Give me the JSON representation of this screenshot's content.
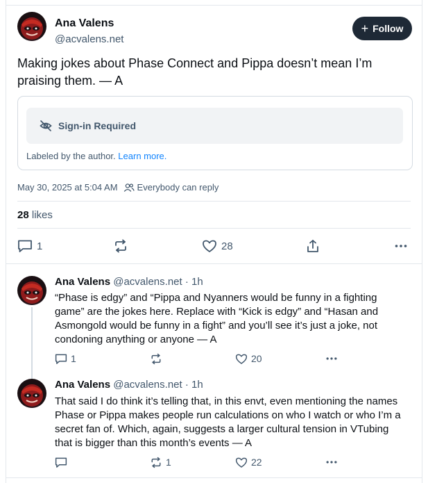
{
  "post": {
    "author_name": "Ana Valens",
    "author_handle": "@acvalens.net",
    "follow_label": "Follow",
    "text": "Making jokes about Phase Connect and Pippa doesn’t mean I’m praising them. — A",
    "content_warning": {
      "label": "Sign-in Required",
      "note": "Labeled by the author.",
      "link": "Learn more."
    },
    "timestamp": "May 30, 2025 at 5:04 AM",
    "reply_setting": "Everybody can reply",
    "likes_count": "28",
    "likes_label": "likes",
    "actions": {
      "replies": "1",
      "reposts": "",
      "likes": "28"
    }
  },
  "replies": [
    {
      "author_name": "Ana Valens",
      "author_handle": "@acvalens.net",
      "age": "· 1h",
      "text": "“Phase is edgy” and “Pippa and Nyanners would be funny in a fighting game” are the jokes here. Replace with “Kick is edgy” and “Hasan and Asmongold would be funny in a fight” and you’ll see it’s just a joke, not condoning anything or anyone — A",
      "replies": "1",
      "reposts": "",
      "likes": "20"
    },
    {
      "author_name": "Ana Valens",
      "author_handle": "@acvalens.net",
      "age": "· 1h",
      "text": "That said I do think it’s telling that, in this envt, even mentioning the names Phase or Pippa makes people run calculations on who I watch or who I’m a secret fan of. Which, again, suggests a larger cultural tension in VTubing that is bigger than this month’s events — A",
      "replies": "",
      "reposts": "1",
      "likes": "22"
    }
  ],
  "icons": {
    "reply": "speech-bubble-icon",
    "repost": "repost-arrows-icon",
    "like": "heart-icon",
    "share": "share-icon",
    "more": "ellipsis-icon",
    "hidden": "eye-slash-icon",
    "people": "people-icon"
  },
  "colors": {
    "accent": "#1083fe",
    "muted": "#42576c",
    "follow_bg": "#1e2936"
  }
}
